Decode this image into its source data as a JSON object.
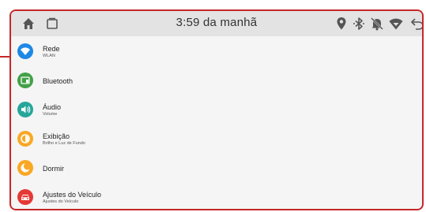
{
  "status_bar": {
    "time": "3:59 da manhã",
    "left_icons": [
      "home-icon",
      "recent-apps-icon"
    ],
    "right_icons": [
      "location-icon",
      "bluetooth-icon",
      "notifications-off-icon",
      "wifi-icon",
      "back-icon"
    ]
  },
  "settings": {
    "items": [
      {
        "title": "Rede",
        "subtitle": "WLAN",
        "icon": "wifi-icon",
        "color": "#1e88e5"
      },
      {
        "title": "Bluetooth",
        "subtitle": "",
        "icon": "bluetooth-device-icon",
        "color": "#43a047"
      },
      {
        "title": "Áudio",
        "subtitle": "Volume",
        "icon": "speaker-icon",
        "color": "#26a69a"
      },
      {
        "title": "Exibição",
        "subtitle": "Brilho e Luz de Fundo",
        "icon": "brightness-icon",
        "color": "#f9a825"
      },
      {
        "title": "Dormir",
        "subtitle": "",
        "icon": "moon-icon",
        "color": "#f9a825"
      },
      {
        "title": "Ajustes do Veículo",
        "subtitle": "Ajustes do Veículo",
        "icon": "car-icon",
        "color": "#e53935"
      }
    ]
  },
  "colors": {
    "frame": "#c62828",
    "status_bar_bg": "#e3e3e3",
    "list_bg": "#f5f5f5"
  }
}
